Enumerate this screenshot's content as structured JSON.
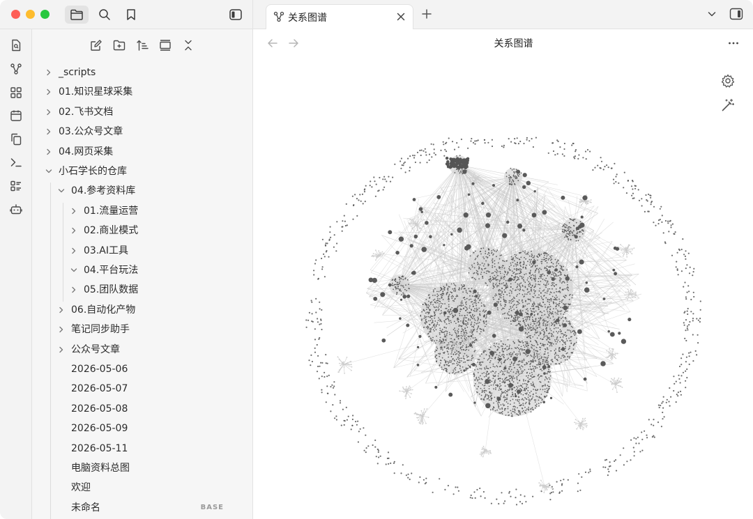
{
  "window": {
    "tab_title": "关系图谱",
    "view_title": "关系图谱"
  },
  "icons": {
    "titlebar": [
      "folder-icon",
      "search-icon",
      "bookmark-icon",
      "sidebar-toggle-icon"
    ],
    "ribbon": [
      "search-file-icon",
      "graph-icon",
      "grid-icon",
      "calendar-icon",
      "copy-icon",
      "terminal-icon",
      "list-icon",
      "bot-icon"
    ],
    "explorer_actions": [
      "new-note-icon",
      "new-folder-icon",
      "sort-icon",
      "collapse-view-icon",
      "collapse-all-icon"
    ]
  },
  "tree": [
    {
      "label": "_scripts",
      "type": "folder",
      "depth": 0,
      "expanded": false
    },
    {
      "label": "01.知识星球采集",
      "type": "folder",
      "depth": 0,
      "expanded": false
    },
    {
      "label": "02.飞书文档",
      "type": "folder",
      "depth": 0,
      "expanded": false
    },
    {
      "label": "03.公众号文章",
      "type": "folder",
      "depth": 0,
      "expanded": false
    },
    {
      "label": "04.网页采集",
      "type": "folder",
      "depth": 0,
      "expanded": false
    },
    {
      "label": "小石学长的仓库",
      "type": "folder",
      "depth": 0,
      "expanded": true
    },
    {
      "label": "04.参考资料库",
      "type": "folder",
      "depth": 1,
      "expanded": true
    },
    {
      "label": "01.流量运营",
      "type": "folder",
      "depth": 2,
      "expanded": false
    },
    {
      "label": "02.商业模式",
      "type": "folder",
      "depth": 2,
      "expanded": false
    },
    {
      "label": "03.AI工具",
      "type": "folder",
      "depth": 2,
      "expanded": false
    },
    {
      "label": "04.平台玩法",
      "type": "folder",
      "depth": 2,
      "expanded": true
    },
    {
      "label": "05.团队数据",
      "type": "folder",
      "depth": 2,
      "expanded": false
    },
    {
      "label": "06.自动化产物",
      "type": "folder",
      "depth": 1,
      "expanded": false
    },
    {
      "label": "笔记同步助手",
      "type": "folder",
      "depth": 1,
      "expanded": false
    },
    {
      "label": "公众号文章",
      "type": "folder",
      "depth": 1,
      "expanded": false
    },
    {
      "label": "2026-05-06",
      "type": "file",
      "depth": 1
    },
    {
      "label": "2026-05-07",
      "type": "file",
      "depth": 1
    },
    {
      "label": "2026-05-08",
      "type": "file",
      "depth": 1
    },
    {
      "label": "2026-05-09",
      "type": "file",
      "depth": 1
    },
    {
      "label": "2026-05-11",
      "type": "file",
      "depth": 1
    },
    {
      "label": "电脑资料总图",
      "type": "file",
      "depth": 1
    },
    {
      "label": "欢迎",
      "type": "file",
      "depth": 1
    },
    {
      "label": "未命名",
      "type": "file",
      "depth": 1,
      "tag": "BASE"
    }
  ],
  "colors": {
    "node": "#555555",
    "edge": "#c8c8c8",
    "sidebar_bg": "#f6f6f6",
    "chrome_bg": "#f3f3f3"
  }
}
